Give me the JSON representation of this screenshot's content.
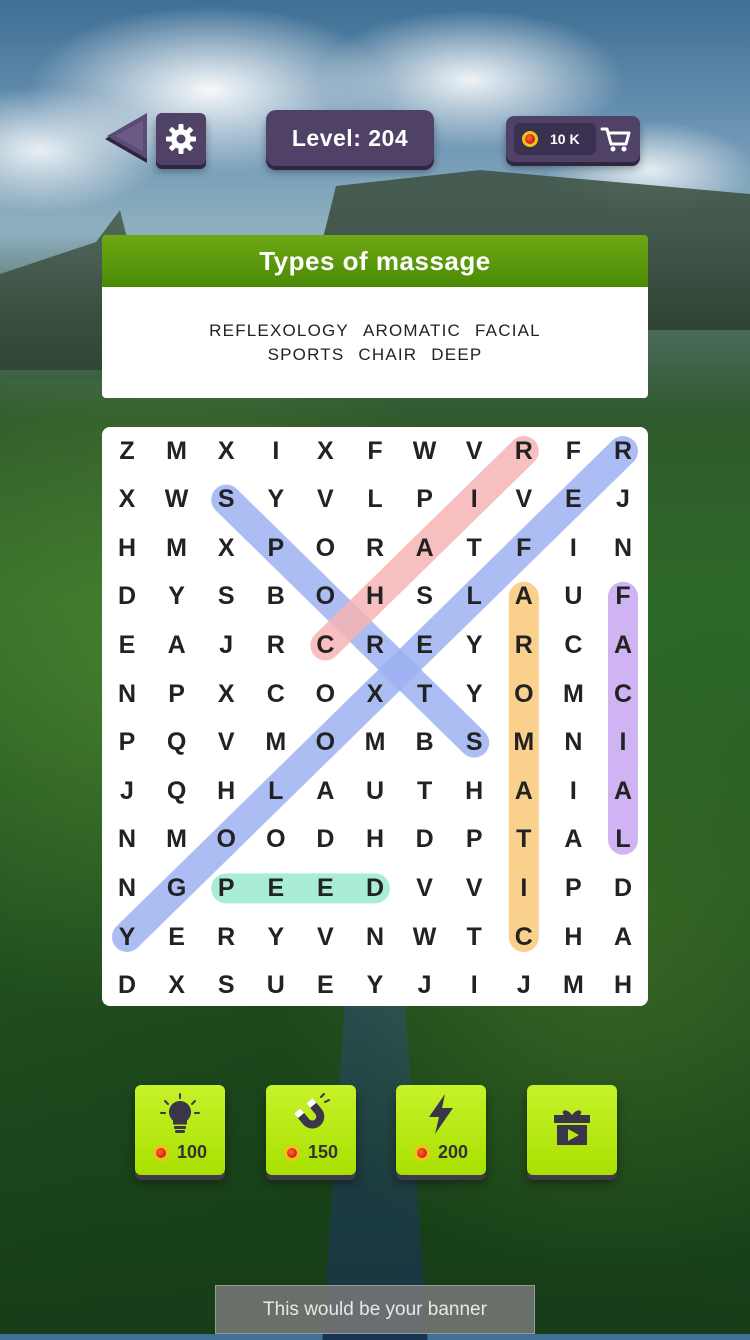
{
  "header": {
    "level_label": "Level: 204",
    "coins": "10 K"
  },
  "category": {
    "title": "Types of massage",
    "words_row1": [
      "REFLEXOLOGY",
      "AROMATIC",
      "FACIAL"
    ],
    "words_row2": [
      "SPORTS",
      "CHAIR",
      "DEEP"
    ]
  },
  "grid": [
    [
      "Z",
      "M",
      "X",
      "I",
      "X",
      "F",
      "W",
      "V",
      "R",
      "F",
      "R"
    ],
    [
      "X",
      "W",
      "S",
      "Y",
      "V",
      "L",
      "P",
      "I",
      "V",
      "E",
      "J"
    ],
    [
      "H",
      "M",
      "X",
      "P",
      "O",
      "R",
      "A",
      "T",
      "F",
      "I",
      "N"
    ],
    [
      "D",
      "Y",
      "S",
      "B",
      "O",
      "H",
      "S",
      "L",
      "A",
      "U",
      "F"
    ],
    [
      "E",
      "A",
      "J",
      "R",
      "C",
      "R",
      "E",
      "Y",
      "R",
      "C",
      "A"
    ],
    [
      "N",
      "P",
      "X",
      "C",
      "O",
      "X",
      "T",
      "Y",
      "O",
      "M",
      "C"
    ],
    [
      "P",
      "Q",
      "V",
      "M",
      "O",
      "M",
      "B",
      "S",
      "M",
      "N",
      "I"
    ],
    [
      "J",
      "Q",
      "H",
      "L",
      "A",
      "U",
      "T",
      "H",
      "A",
      "I",
      "A"
    ],
    [
      "N",
      "M",
      "O",
      "O",
      "D",
      "H",
      "D",
      "P",
      "T",
      "A",
      "L"
    ],
    [
      "N",
      "G",
      "P",
      "E",
      "E",
      "D",
      "V",
      "V",
      "I",
      "P",
      "D"
    ],
    [
      "Y",
      "E",
      "R",
      "Y",
      "V",
      "N",
      "W",
      "T",
      "C",
      "H",
      "A"
    ],
    [
      "D",
      "X",
      "S",
      "U",
      "E",
      "Y",
      "J",
      "I",
      "J",
      "M",
      "H"
    ]
  ],
  "highlights": [
    {
      "word": "REFLEXOLOGY",
      "from": [
        0,
        10
      ],
      "to": [
        10,
        0
      ],
      "color": "#9db2f2"
    },
    {
      "word": "SPORTS",
      "from": [
        1,
        2
      ],
      "to": [
        6,
        7
      ],
      "color": "#9db2f2"
    },
    {
      "word": "CHAIR",
      "from": [
        4,
        4
      ],
      "to": [
        0,
        8
      ],
      "color": "#f6b4b4"
    },
    {
      "word": "AROMATIC",
      "from": [
        3,
        8
      ],
      "to": [
        10,
        8
      ],
      "color": "#f8c979"
    },
    {
      "word": "FACIAL",
      "from": [
        3,
        10
      ],
      "to": [
        8,
        10
      ],
      "color": "#c8a6f2"
    },
    {
      "word": "PEED",
      "from": [
        9,
        2
      ],
      "to": [
        9,
        5
      ],
      "color": "#9cebcf"
    }
  ],
  "powerups": [
    {
      "name": "hint",
      "icon": "lightbulb-icon",
      "cost": "100"
    },
    {
      "name": "magnet",
      "icon": "magnet-icon",
      "cost": "150"
    },
    {
      "name": "lightning",
      "icon": "lightning-icon",
      "cost": "200"
    },
    {
      "name": "video-gift",
      "icon": "gift-video-icon",
      "cost": ""
    }
  ],
  "banner": "This would be your banner",
  "colors": {
    "badge_purple": "#4f4266",
    "category_green": "#5c9a0c",
    "powerup_lime": "#b6ea10"
  }
}
